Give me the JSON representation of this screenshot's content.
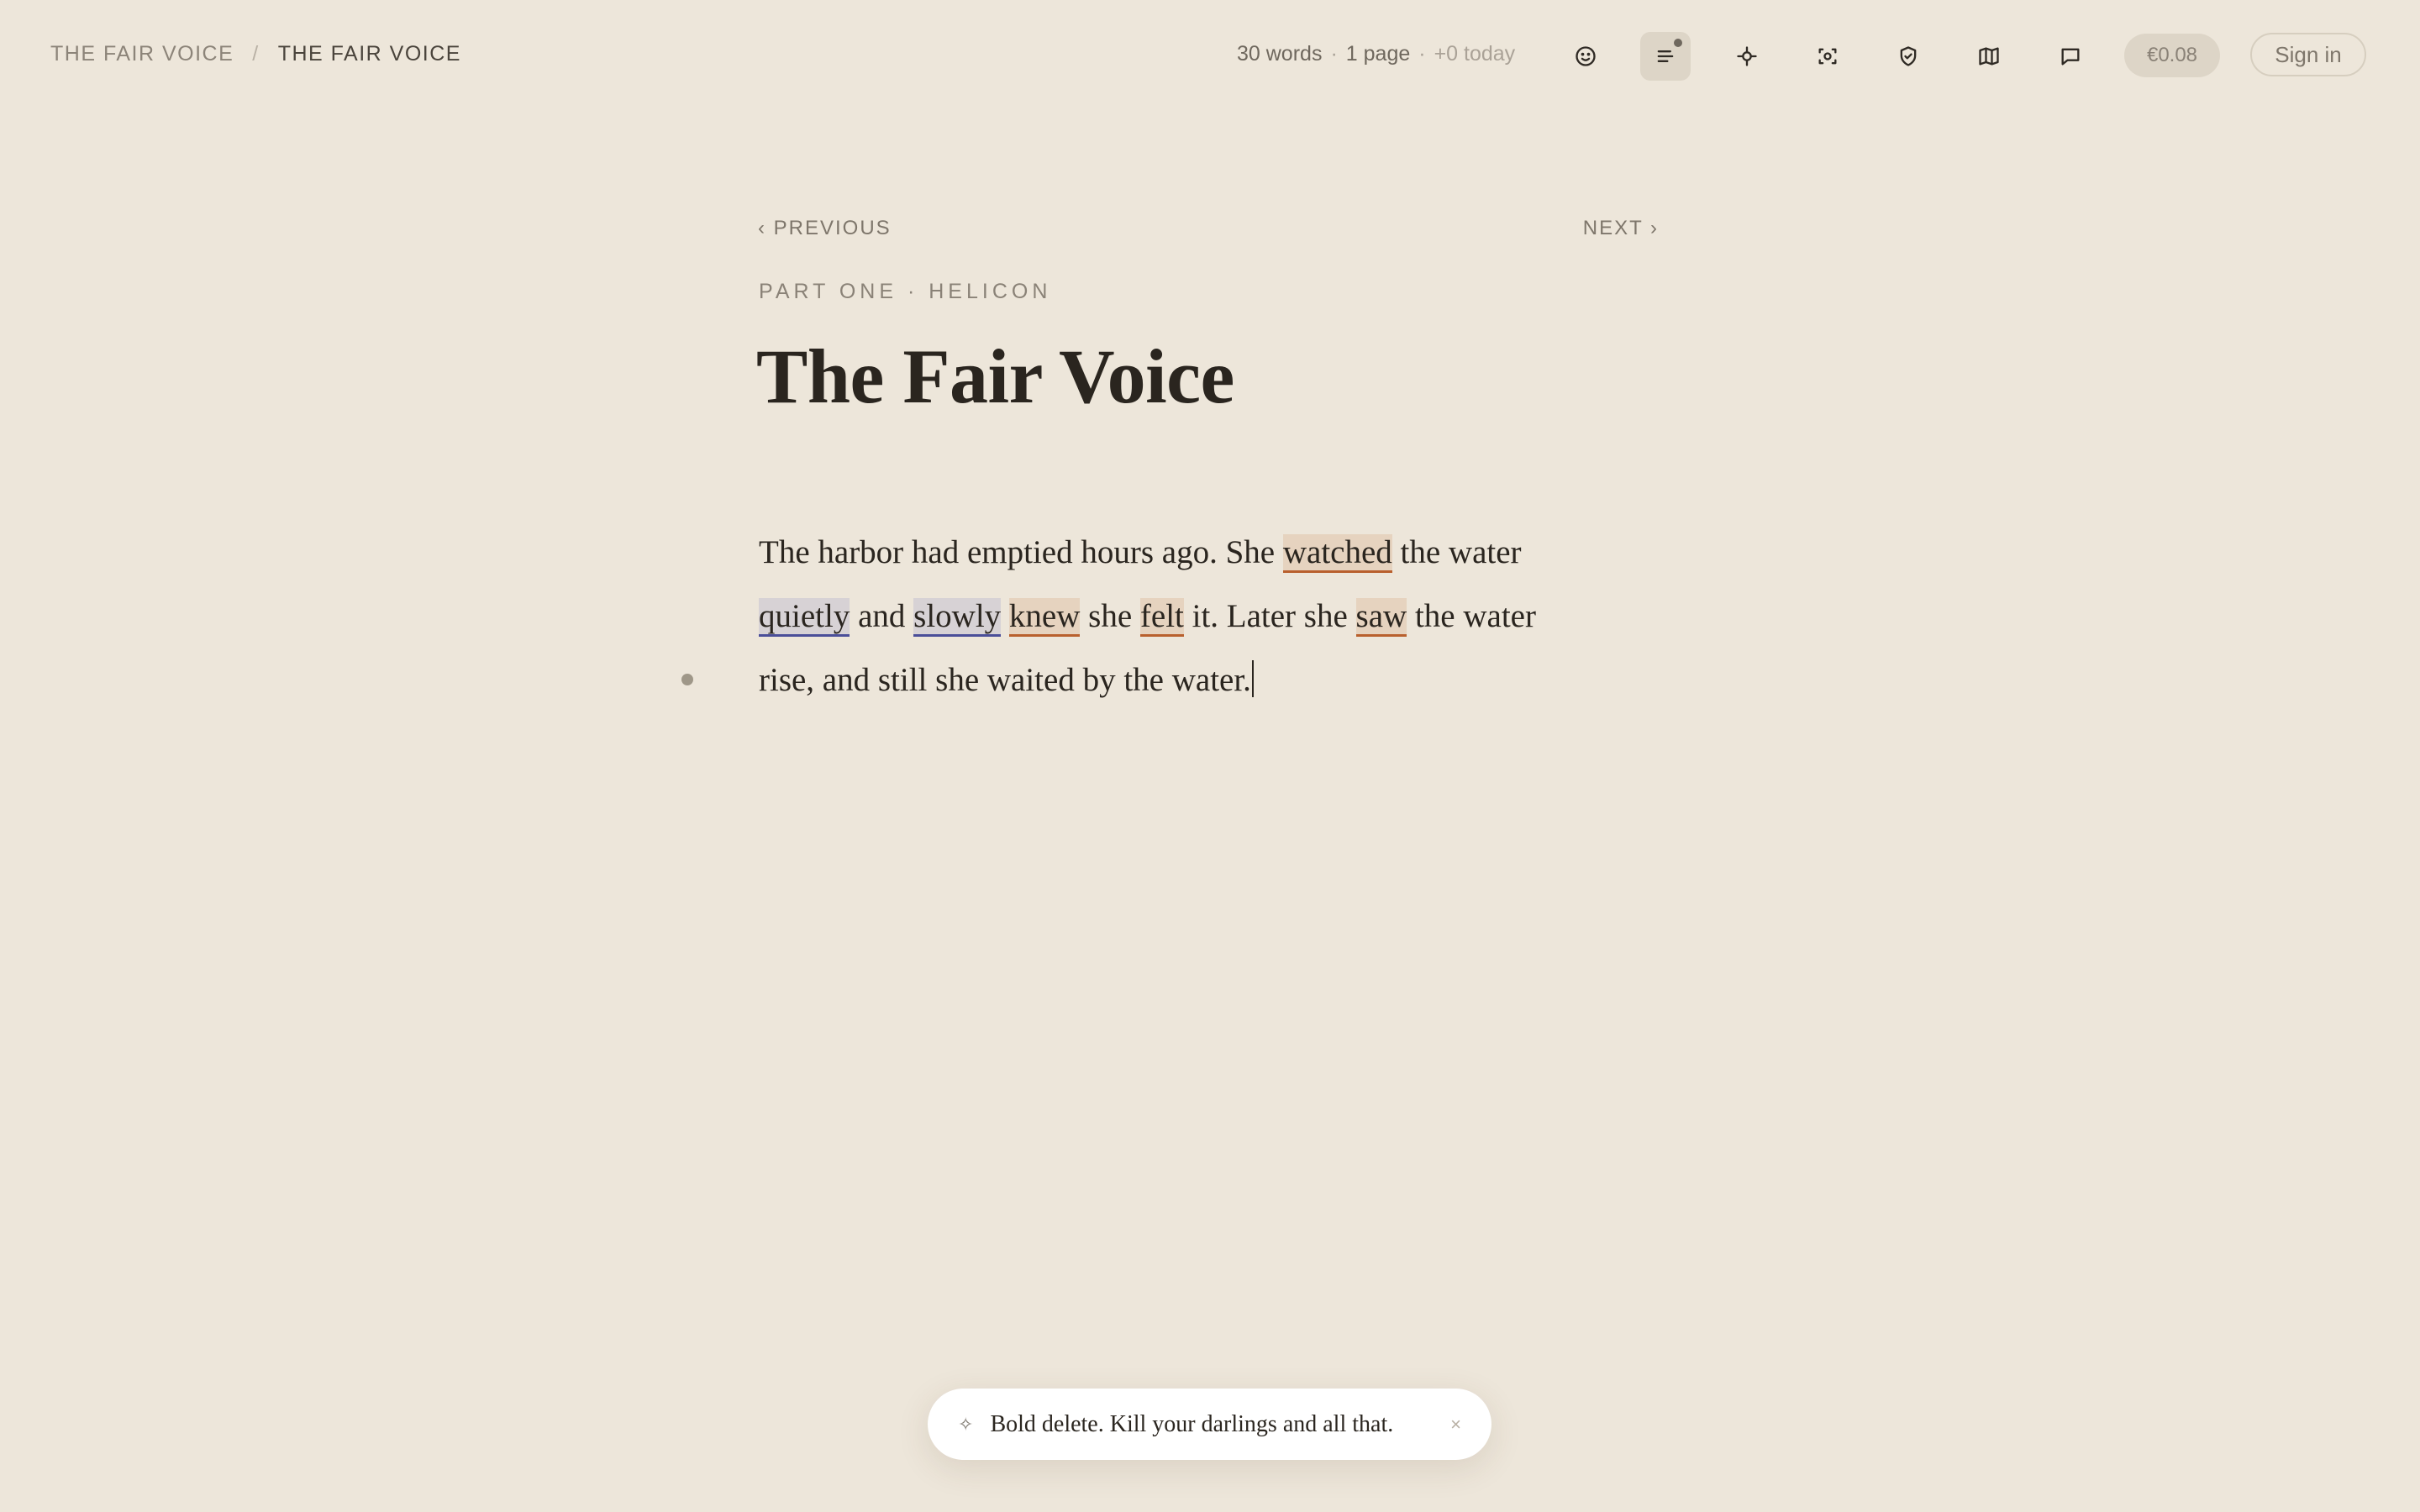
{
  "breadcrumb": {
    "root": "THE FAIR VOICE",
    "separator": "/",
    "current": "THE FAIR VOICE"
  },
  "stats": {
    "words": "30 words",
    "dot1": "·",
    "pages": "1 page",
    "dot2": "·",
    "today": "+0 today"
  },
  "toolbar": {
    "icons": [
      "face-icon",
      "outline-icon",
      "focus-icon",
      "screenshot-icon",
      "shield-check-icon",
      "map-icon",
      "comment-icon"
    ],
    "active_icon": "outline-icon",
    "cost": "€0.08",
    "sign_in": "Sign in"
  },
  "nav": {
    "previous": "‹ PREVIOUS",
    "next": "NEXT ›"
  },
  "document": {
    "part": "PART ONE · HELICON",
    "title": "The Fair Voice",
    "lines": [
      [
        {
          "text": "The harbor had emptied hours ago. She ",
          "hl": ""
        },
        {
          "text": "watched",
          "hl": "verb"
        },
        {
          "text": " the water",
          "hl": ""
        }
      ],
      [
        {
          "text": "quietly",
          "hl": "adv"
        },
        {
          "text": " and ",
          "hl": ""
        },
        {
          "text": "slowly",
          "hl": "adv"
        },
        {
          "text": " ",
          "hl": ""
        },
        {
          "text": "knew",
          "hl": "verb"
        },
        {
          "text": " she ",
          "hl": ""
        },
        {
          "text": "felt",
          "hl": "verb"
        },
        {
          "text": " it. Later she ",
          "hl": ""
        },
        {
          "text": "saw",
          "hl": "verb"
        },
        {
          "text": " the water",
          "hl": ""
        }
      ],
      [
        {
          "text": "rise, and still she waited by the water.",
          "hl": ""
        }
      ]
    ]
  },
  "toast": {
    "icon": "✧",
    "message": "Bold delete. Kill your darlings and all that.",
    "close": "×"
  },
  "colors": {
    "background": "#ede6da",
    "verb_highlight": "#e6d3bf",
    "verb_underline": "#b9602d",
    "adverb_highlight": "#d7d2d5",
    "adverb_underline": "#4a4e99"
  }
}
